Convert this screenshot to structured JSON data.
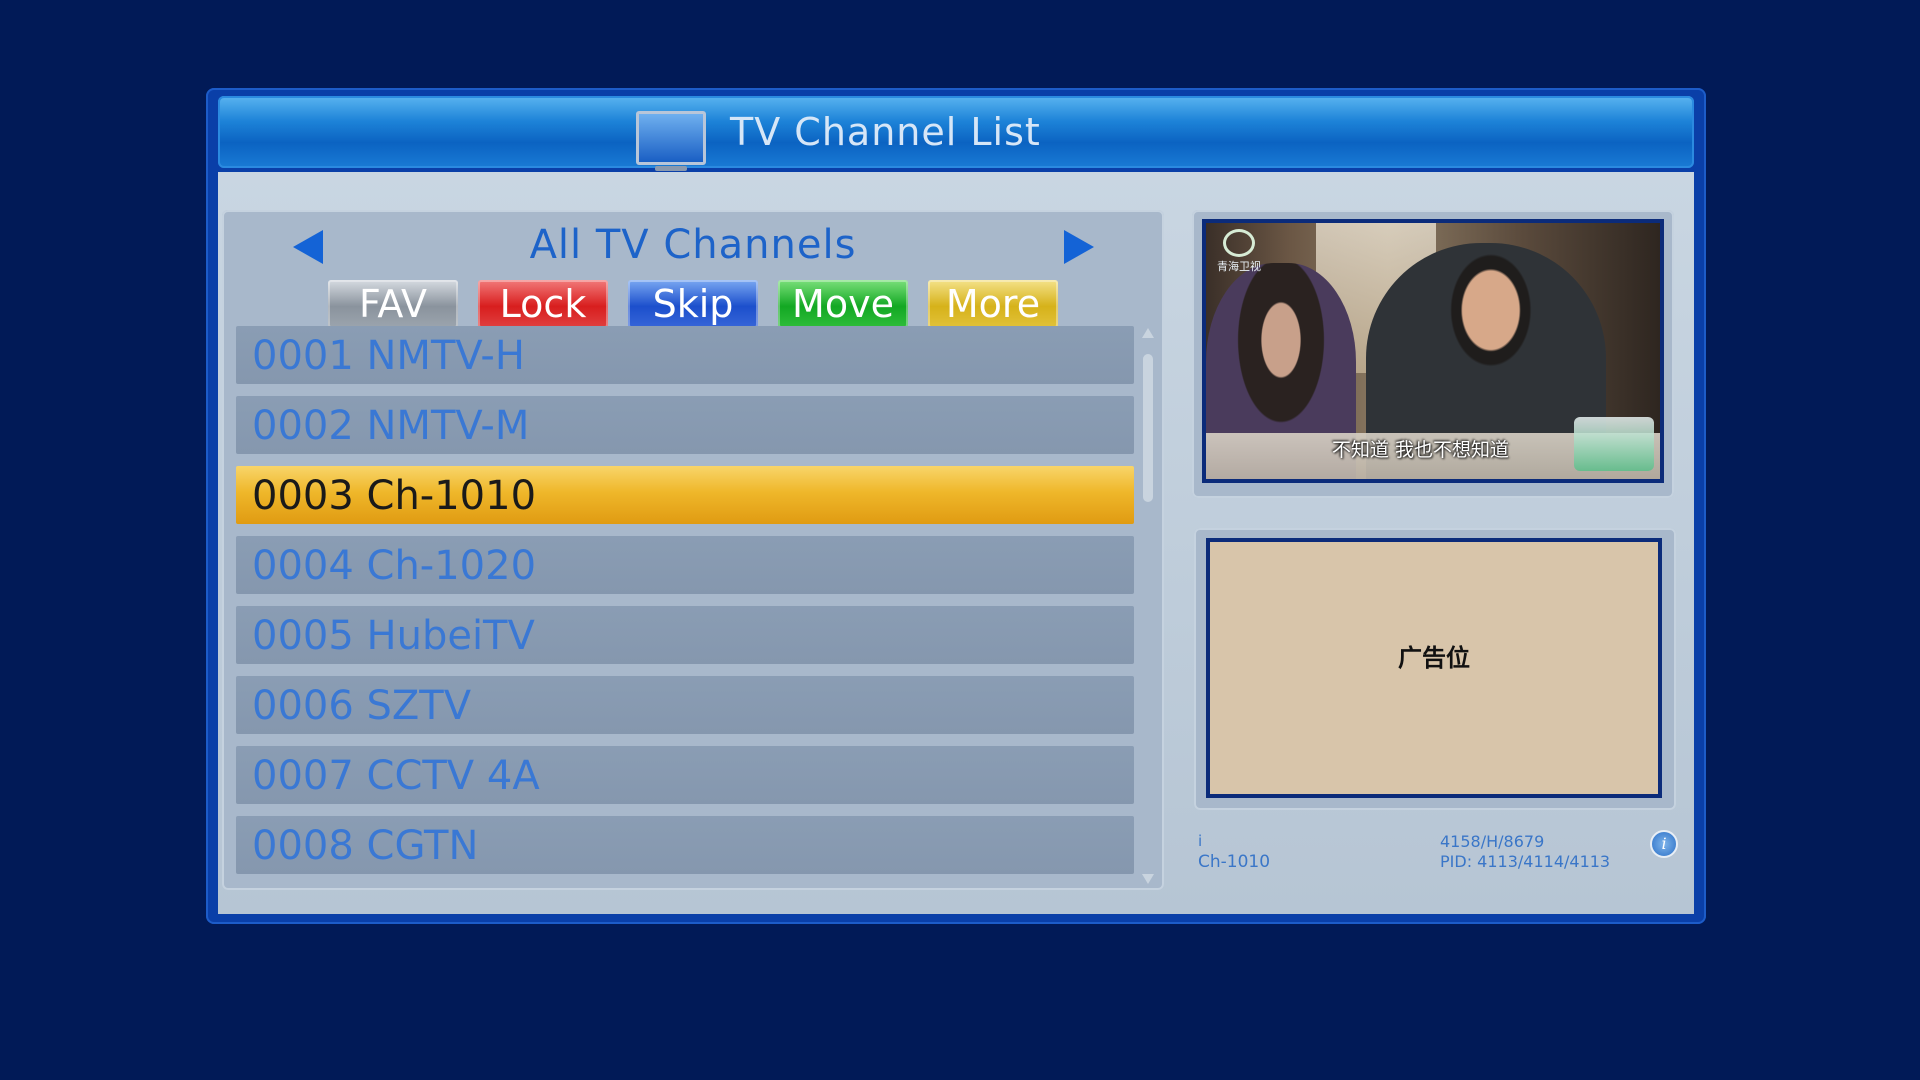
{
  "window": {
    "title": "TV Channel List",
    "icon": "tv-icon"
  },
  "list": {
    "group_title": "All TV Channels",
    "buttons": {
      "fav": "FAV",
      "lock": "Lock",
      "skip": "Skip",
      "move": "Move",
      "more": "More"
    },
    "channels": [
      {
        "label": "0001 NMTV-H",
        "selected": false
      },
      {
        "label": "0002 NMTV-M",
        "selected": false
      },
      {
        "label": "0003 Ch-1010",
        "selected": true
      },
      {
        "label": "0004 Ch-1020",
        "selected": false
      },
      {
        "label": "0005 HubeiTV",
        "selected": false
      },
      {
        "label": "0006 SZTV",
        "selected": false
      },
      {
        "label": "0007 CCTV 4A",
        "selected": false
      },
      {
        "label": "0008 CGTN",
        "selected": false
      }
    ]
  },
  "preview": {
    "station_logo_text": "青海卫视",
    "subtitle": "不知道 我也不想知道"
  },
  "ad": {
    "text": "广告位"
  },
  "info": {
    "i_label": "i",
    "channel_name": "Ch-1010",
    "frequency": "4158/H/8679",
    "pid": "PID: 4113/4114/4113",
    "info_icon_glyph": "i"
  },
  "colors": {
    "background": "#011a57",
    "title_bar": "#1d83d8",
    "selected_row": "#efb72a",
    "row_text": "#3a78d4",
    "fav": "#9ca5ae",
    "lock": "#d81e1e",
    "skip": "#1c4fcc",
    "move": "#13a823",
    "more": "#d6b21a"
  }
}
